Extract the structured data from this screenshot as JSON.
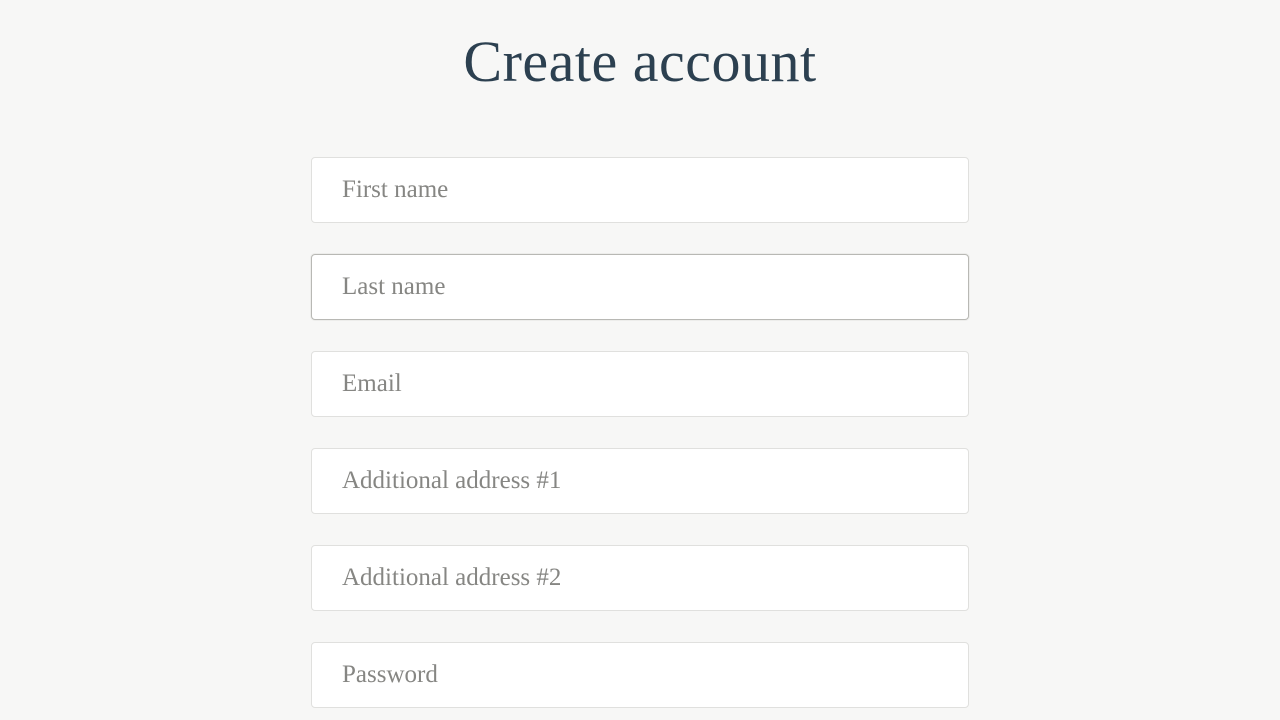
{
  "header": {
    "title": "Create account"
  },
  "form": {
    "fields": {
      "first_name": {
        "placeholder": "First name",
        "value": ""
      },
      "last_name": {
        "placeholder": "Last name",
        "value": ""
      },
      "email": {
        "placeholder": "Email",
        "value": ""
      },
      "address1": {
        "placeholder": "Additional address #1",
        "value": ""
      },
      "address2": {
        "placeholder": "Additional address #2",
        "value": ""
      },
      "password": {
        "placeholder": "Password",
        "value": ""
      }
    }
  }
}
